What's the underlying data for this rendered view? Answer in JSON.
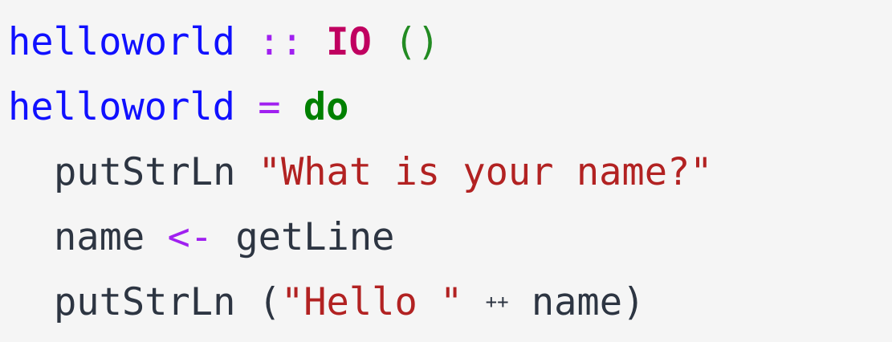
{
  "code": {
    "lines": [
      {
        "tokens": {
          "fn": "helloworld",
          "sep1": " ",
          "op": "::",
          "sep2": " ",
          "type": "IO",
          "sep3": " ",
          "unit": "()"
        }
      },
      {
        "tokens": {
          "fn": "helloworld",
          "sep1": " ",
          "op": "=",
          "sep2": " ",
          "kw": "do"
        }
      },
      {
        "tokens": {
          "fn": "putStrLn",
          "sep1": " ",
          "str": "\"What is your name?\""
        }
      },
      {
        "tokens": {
          "name": "name",
          "sep1": " ",
          "op": "<-",
          "sep2": " ",
          "fn": "getLine"
        }
      },
      {
        "tokens": {
          "fn": "putStrLn",
          "sep1": " ",
          "open": "(",
          "str": "\"Hello \"",
          "sep2": " ",
          "op": "++",
          "sep3": " ",
          "name": "name",
          "close": ")"
        }
      }
    ]
  }
}
